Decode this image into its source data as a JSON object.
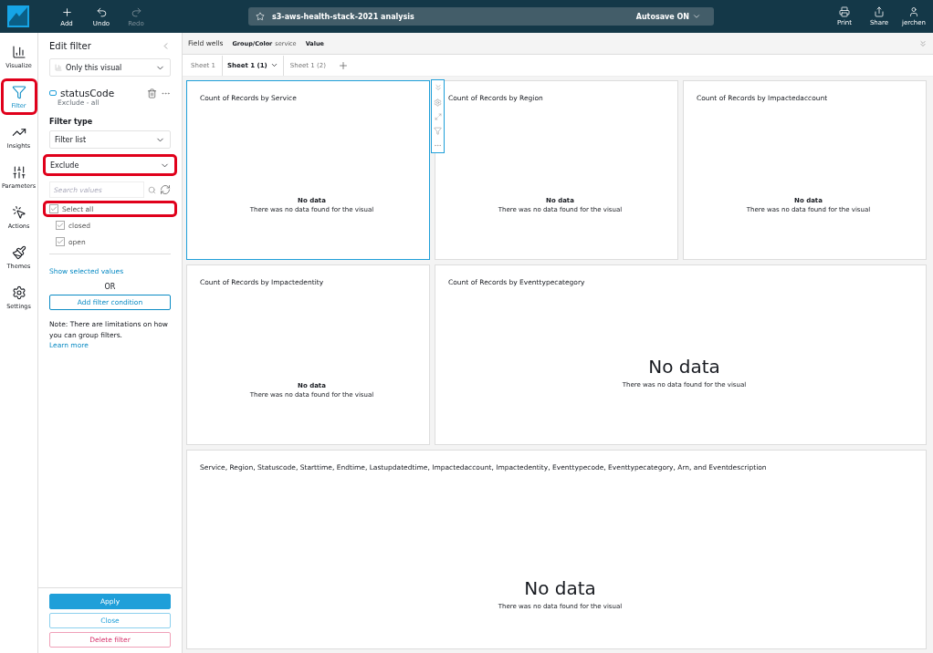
{
  "topbar": {
    "actions": [
      {
        "label": "Add",
        "disabled": false
      },
      {
        "label": "Undo",
        "disabled": false
      },
      {
        "label": "Redo",
        "disabled": true
      }
    ],
    "title": "s3-aws-health-stack-2021 analysis",
    "autosave": "Autosave ON",
    "right": [
      {
        "label": "Print"
      },
      {
        "label": "Share"
      },
      {
        "label": "jerchen"
      }
    ]
  },
  "rail": [
    {
      "label": "Visualize",
      "selected": false,
      "highlighted": false
    },
    {
      "label": "Filter",
      "selected": true,
      "highlighted": true
    },
    {
      "label": "Insights",
      "selected": false,
      "highlighted": false
    },
    {
      "label": "Parameters",
      "selected": false,
      "highlighted": false
    },
    {
      "label": "Actions",
      "selected": false,
      "highlighted": false
    },
    {
      "label": "Themes",
      "selected": false,
      "highlighted": false
    },
    {
      "label": "Settings",
      "selected": false,
      "highlighted": false
    }
  ],
  "filter": {
    "title": "Edit filter",
    "scope": "Only this visual",
    "field": "statusCode",
    "summary": "Exclude - all",
    "type_label": "Filter type",
    "type": "Filter list",
    "mode": {
      "value": "Exclude",
      "highlighted": true
    },
    "search": {
      "placeholder": "Search values"
    },
    "values": [
      {
        "label": "Select all",
        "checked": true,
        "highlighted": true
      },
      {
        "label": "closed",
        "checked": true,
        "highlighted": false
      },
      {
        "label": "open",
        "checked": true,
        "highlighted": false
      }
    ],
    "show_selected": "Show selected values",
    "or": "OR",
    "add_condition": "Add filter condition",
    "note": "Note: There are limitations on how you can group filters.",
    "learn_more": "Learn more",
    "buttons": [
      {
        "label": "Apply",
        "kind": "primary"
      },
      {
        "label": "Close",
        "kind": "secondary"
      },
      {
        "label": "Delete filter",
        "kind": "danger"
      }
    ]
  },
  "field_wells": {
    "label": "Field wells",
    "wells": [
      {
        "label": "Group/Color",
        "value": "service"
      },
      {
        "label": "Value"
      }
    ]
  },
  "sheets": [
    {
      "label": "Sheet 1",
      "selected": false
    },
    {
      "label": "Sheet 1 (1)",
      "selected": true
    },
    {
      "label": "Sheet 1 (2)",
      "selected": false
    }
  ],
  "visuals": [
    {
      "title": "Count of Records by Service",
      "selected": true,
      "kind": "compact",
      "heading": "No data",
      "message": "There was no data found for the visual"
    },
    {
      "title": "Count of Records by Region",
      "selected": false,
      "kind": "compact",
      "heading": "No data",
      "message": "There was no data found for the visual"
    },
    {
      "title": "Count of Records by Impactedaccount",
      "selected": false,
      "kind": "compact",
      "heading": "No data",
      "message": "There was no data found for the visual"
    },
    {
      "title": "Count of Records by Impactedentity",
      "selected": false,
      "kind": "compact",
      "heading": "No data",
      "message": "There was no data found for the visual"
    },
    {
      "title": "Count of Records by Eventtypecategory",
      "selected": false,
      "kind": "wide",
      "heading": "No data",
      "message": "There was no data found for the visual"
    },
    {
      "title": "Service, Region, Statuscode, Starttime, Endtime, Lastupdatedtime, Impactedaccount, Impactedentity, Eventtypecode, Eventtypecategory, Arn, and Eventdescription",
      "selected": false,
      "kind": "wide",
      "heading": "No data",
      "message": "There was no data found for the visual"
    }
  ]
}
